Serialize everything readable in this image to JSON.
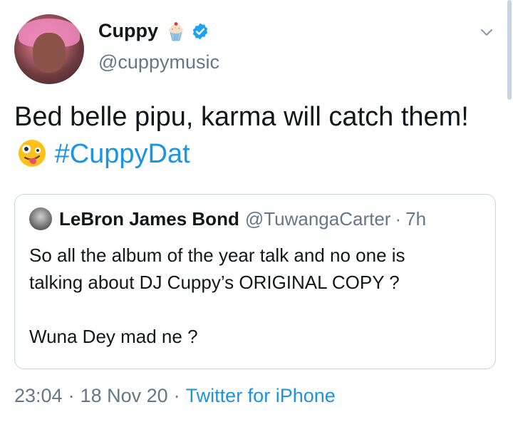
{
  "tweet": {
    "author": {
      "display_name": "Cuppy",
      "handle": "@cuppymusic",
      "name_emoji": "cupcake-icon",
      "verified": true
    },
    "text_main": "Bed belle pipu, karma will catch them!",
    "text_emoji": "zany-face-icon",
    "hashtag": "#CuppyDat",
    "quoted": {
      "display_name": "LeBron James Bond",
      "handle": "@TuwangaCarter",
      "separator": "·",
      "time": "7h",
      "line1": "So all the album of the year talk and no one is",
      "line2": "talking about DJ Cuppy’s ORIGINAL COPY ?",
      "line3": "Wuna Dey mad ne ?"
    },
    "meta": {
      "time": "23:04",
      "separator": "·",
      "date": "18 Nov 20",
      "source": "Twitter for iPhone"
    }
  },
  "colors": {
    "link": "#1b95e0",
    "secondary_text": "#657786",
    "border": "#ccd6dd",
    "verified": "#1da1f2"
  }
}
